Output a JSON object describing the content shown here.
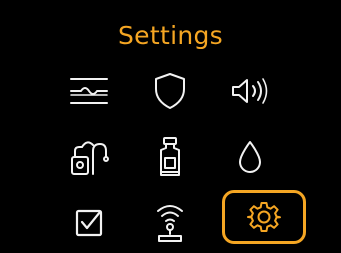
{
  "colors": {
    "background": "#000000",
    "accent": "#f5a623",
    "icon": "#f2f2f2"
  },
  "screen": {
    "title": "Settings"
  },
  "menu": {
    "selected_index": 8,
    "items": [
      {
        "icon": "graph-line-icon"
      },
      {
        "icon": "shield-icon"
      },
      {
        "icon": "speaker-volume-icon"
      },
      {
        "icon": "pump-tubing-icon"
      },
      {
        "icon": "insulin-cartridge-icon"
      },
      {
        "icon": "drop-icon"
      },
      {
        "icon": "checkbox-icon"
      },
      {
        "icon": "wireless-sensor-icon"
      },
      {
        "icon": "gear-icon"
      }
    ]
  }
}
